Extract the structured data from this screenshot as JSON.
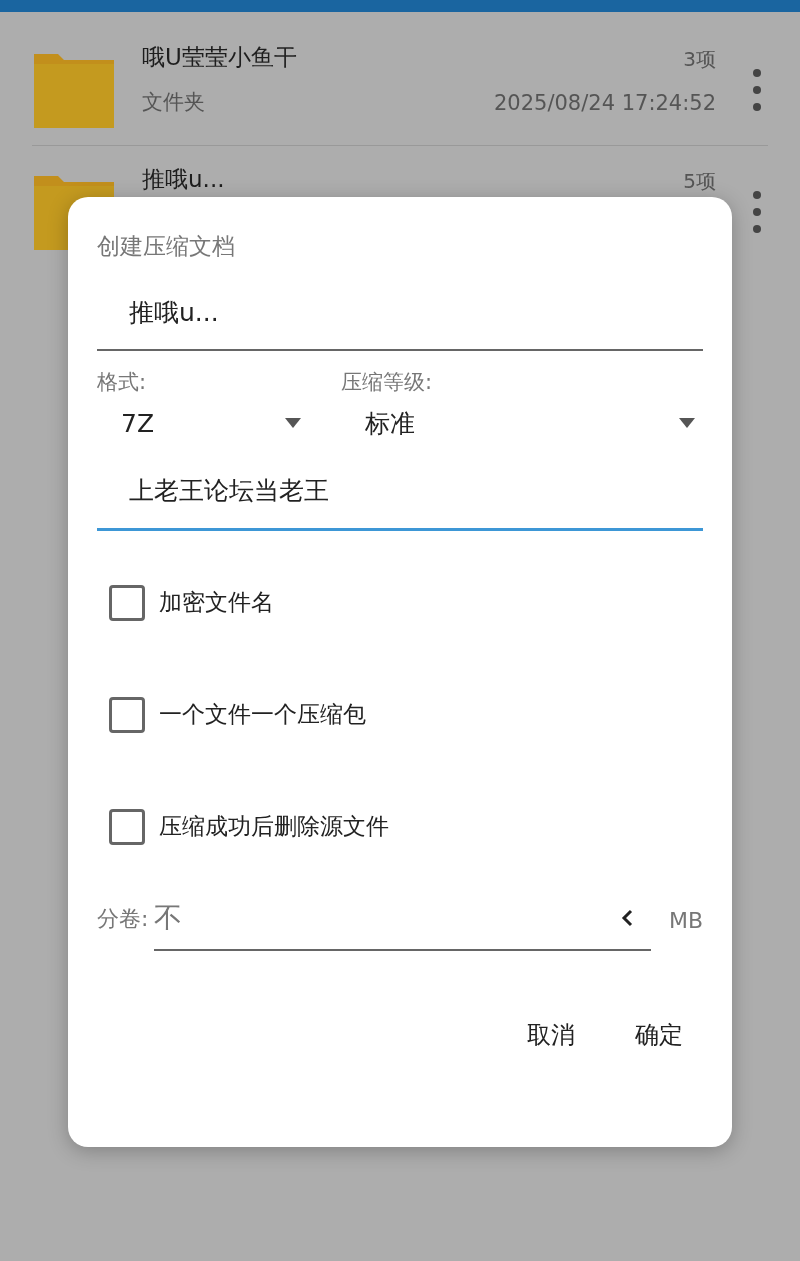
{
  "files": [
    {
      "name": "哦U莹莹小鱼干",
      "count": "3项",
      "type": "文件夹",
      "date": "2025/08/24 17:24:52"
    },
    {
      "name": "推哦u...",
      "count": "5项"
    }
  ],
  "dialog": {
    "title": "创建压缩文档",
    "filename": "推哦u...",
    "format": {
      "label": "格式:",
      "value": "7Z"
    },
    "level": {
      "label": "压缩等级:",
      "value": "标准"
    },
    "password": {
      "value": "上老王论坛当老王",
      "focused": true
    },
    "options": [
      {
        "label": "加密文件名",
        "checked": false
      },
      {
        "label": "一个文件一个压缩包",
        "checked": false
      },
      {
        "label": "压缩成功后删除源文件",
        "checked": false
      }
    ],
    "split": {
      "label": "分卷:",
      "placeholder": "不",
      "unit": "MB"
    },
    "buttons": [
      "取消",
      "确定"
    ]
  }
}
